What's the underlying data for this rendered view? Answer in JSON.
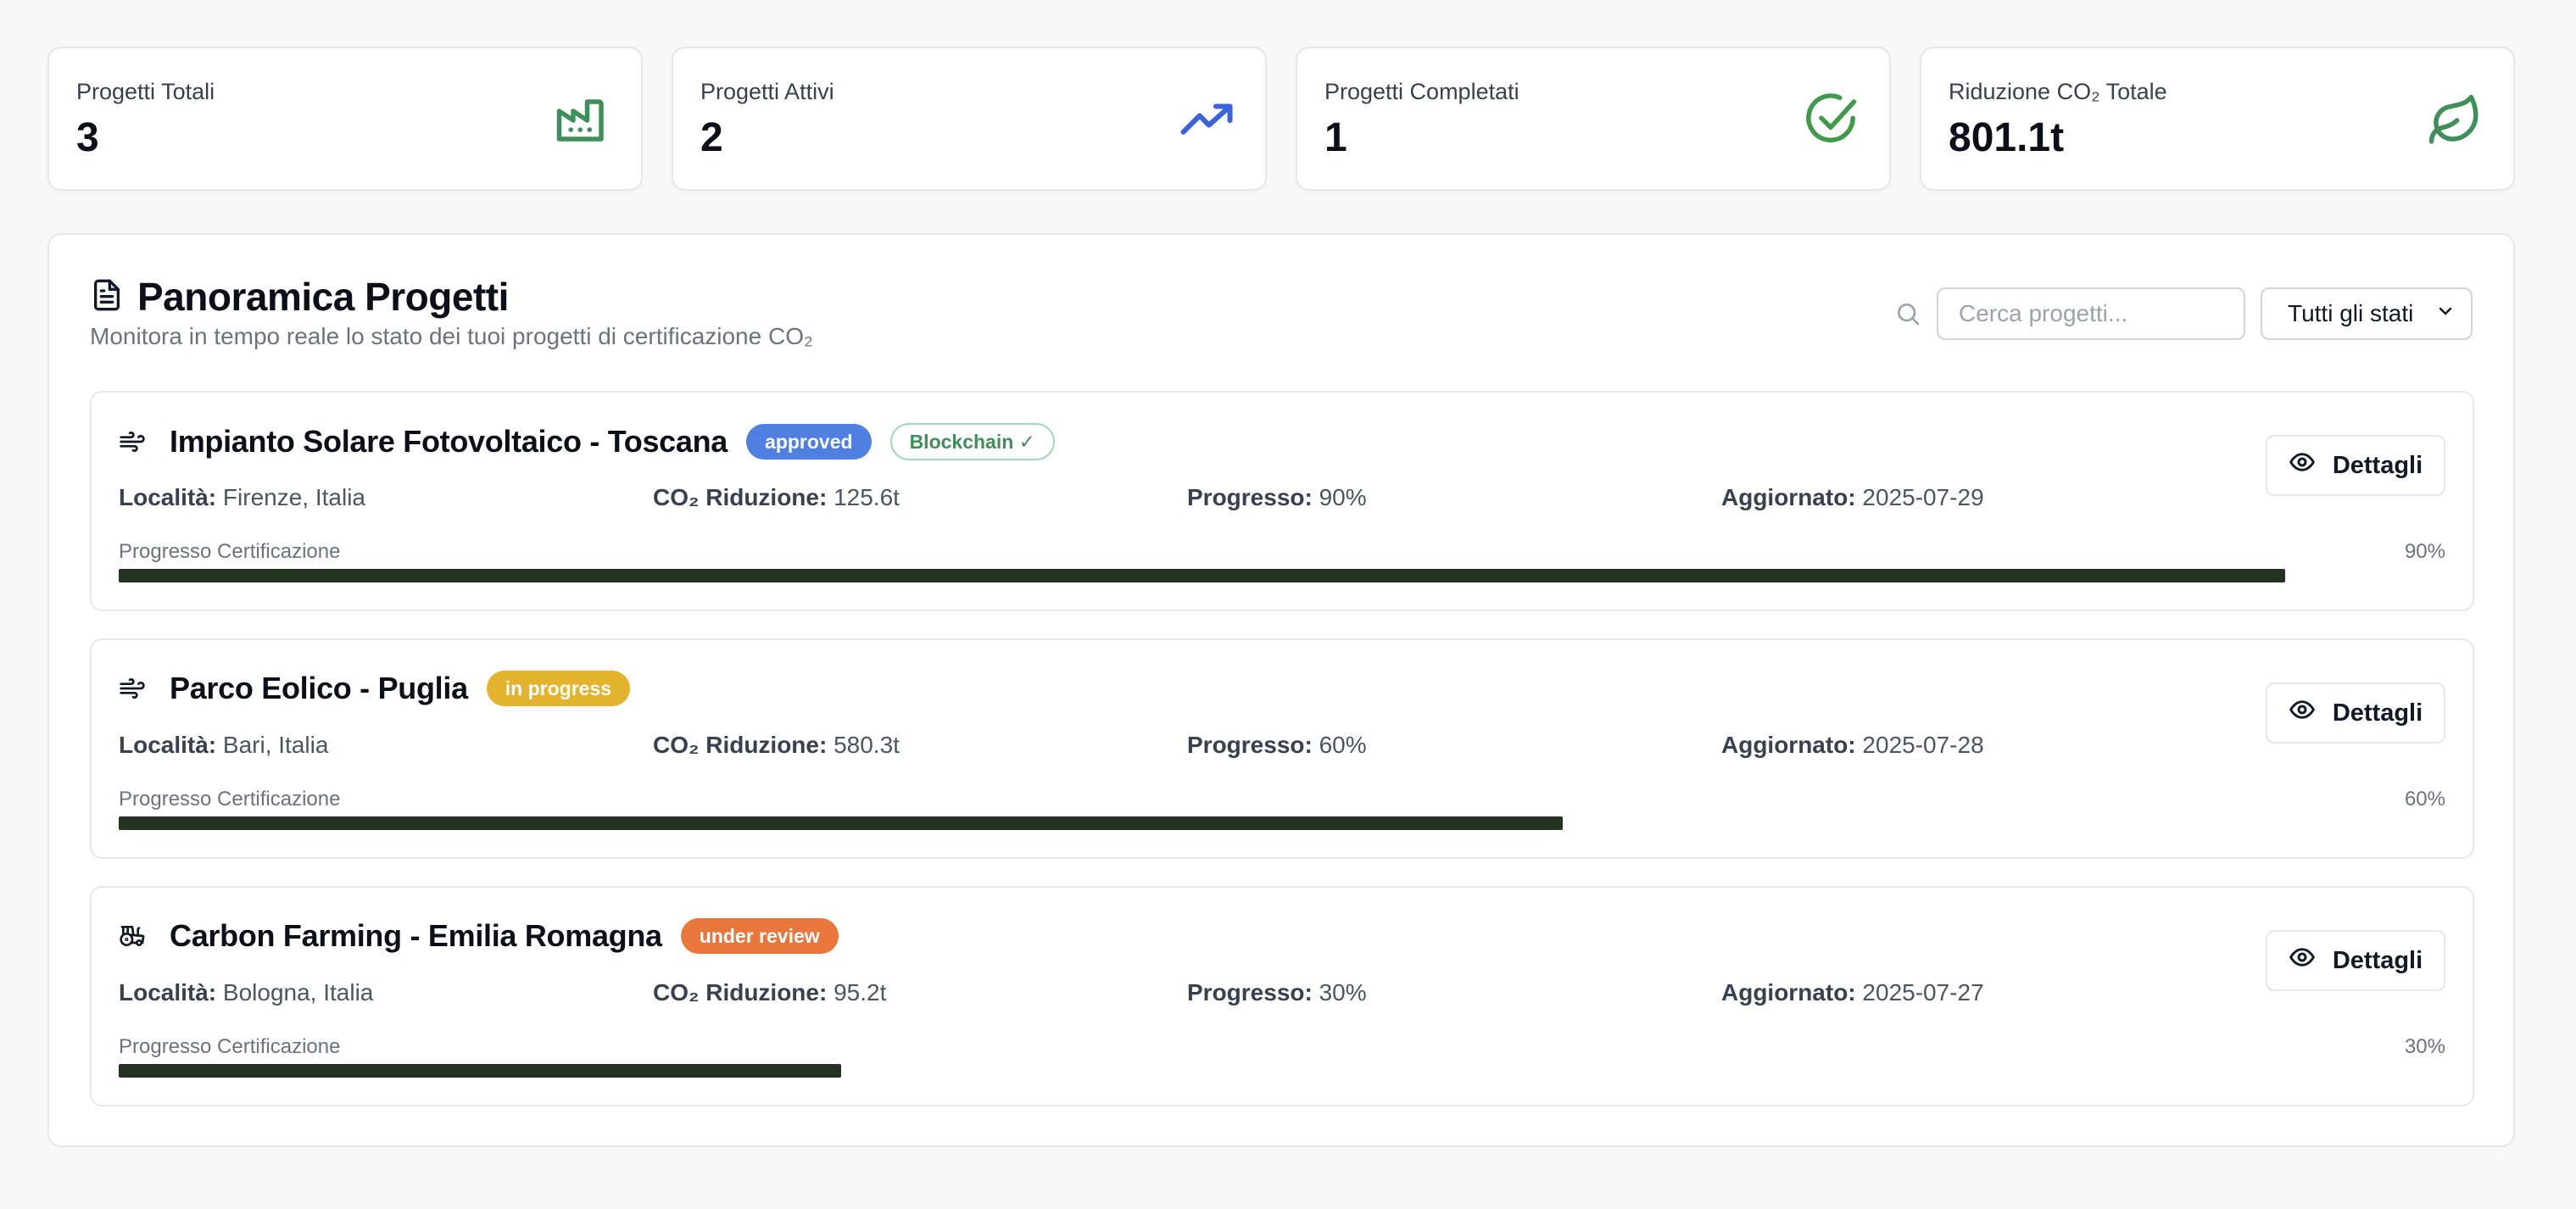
{
  "stats": [
    {
      "label": "Progetti Totali",
      "value": "3",
      "icon": "factory-icon",
      "color": "#3f8f5a"
    },
    {
      "label": "Progetti Attivi",
      "value": "2",
      "icon": "trending-up-icon",
      "color": "#3b63d9"
    },
    {
      "label": "Progetti Completati",
      "value": "1",
      "icon": "check-circle-icon",
      "color": "#3f9a4a"
    },
    {
      "label": "Riduzione CO₂ Totale",
      "value": "801.1t",
      "icon": "leaf-icon",
      "color": "#3f8f5a"
    }
  ],
  "panel": {
    "title": "Panoramica Progetti",
    "subtitle": "Monitora in tempo reale lo stato dei tuoi progetti di certificazione CO₂",
    "search_placeholder": "Cerca progetti...",
    "status_filter": "Tutti gli stati"
  },
  "labels": {
    "location": "Località:",
    "co2": "CO₂ Riduzione:",
    "progress": "Progresso:",
    "updated": "Aggiornato:",
    "progress_cert": "Progresso Certificazione",
    "details": "Dettagli"
  },
  "projects": [
    {
      "name": "Impianto Solare Fotovoltaico - Toscana",
      "icon": "wind-icon",
      "status": "approved",
      "status_color": "#4f7fe0",
      "blockchain": "Blockchain ✓",
      "location": "Firenze, Italia",
      "co2": "125.6t",
      "progress_text": "90%",
      "progress": 0.9,
      "updated": "2025-07-29"
    },
    {
      "name": "Parco Eolico - Puglia",
      "icon": "wind-icon",
      "status": "in progress",
      "status_color": "#e4b32e",
      "location": "Bari, Italia",
      "co2": "580.3t",
      "progress_text": "60%",
      "progress": 0.6,
      "updated": "2025-07-28"
    },
    {
      "name": "Carbon Farming - Emilia Romagna",
      "icon": "tractor-icon",
      "status": "under review",
      "status_color": "#e9763a",
      "location": "Bologna, Italia",
      "co2": "95.2t",
      "progress_text": "30%",
      "progress": 0.3,
      "updated": "2025-07-27"
    }
  ],
  "colors": {
    "blockchain_text": "#3f8f5a",
    "blockchain_border": "#9fd8b4",
    "progress_fill": "#22331f"
  }
}
